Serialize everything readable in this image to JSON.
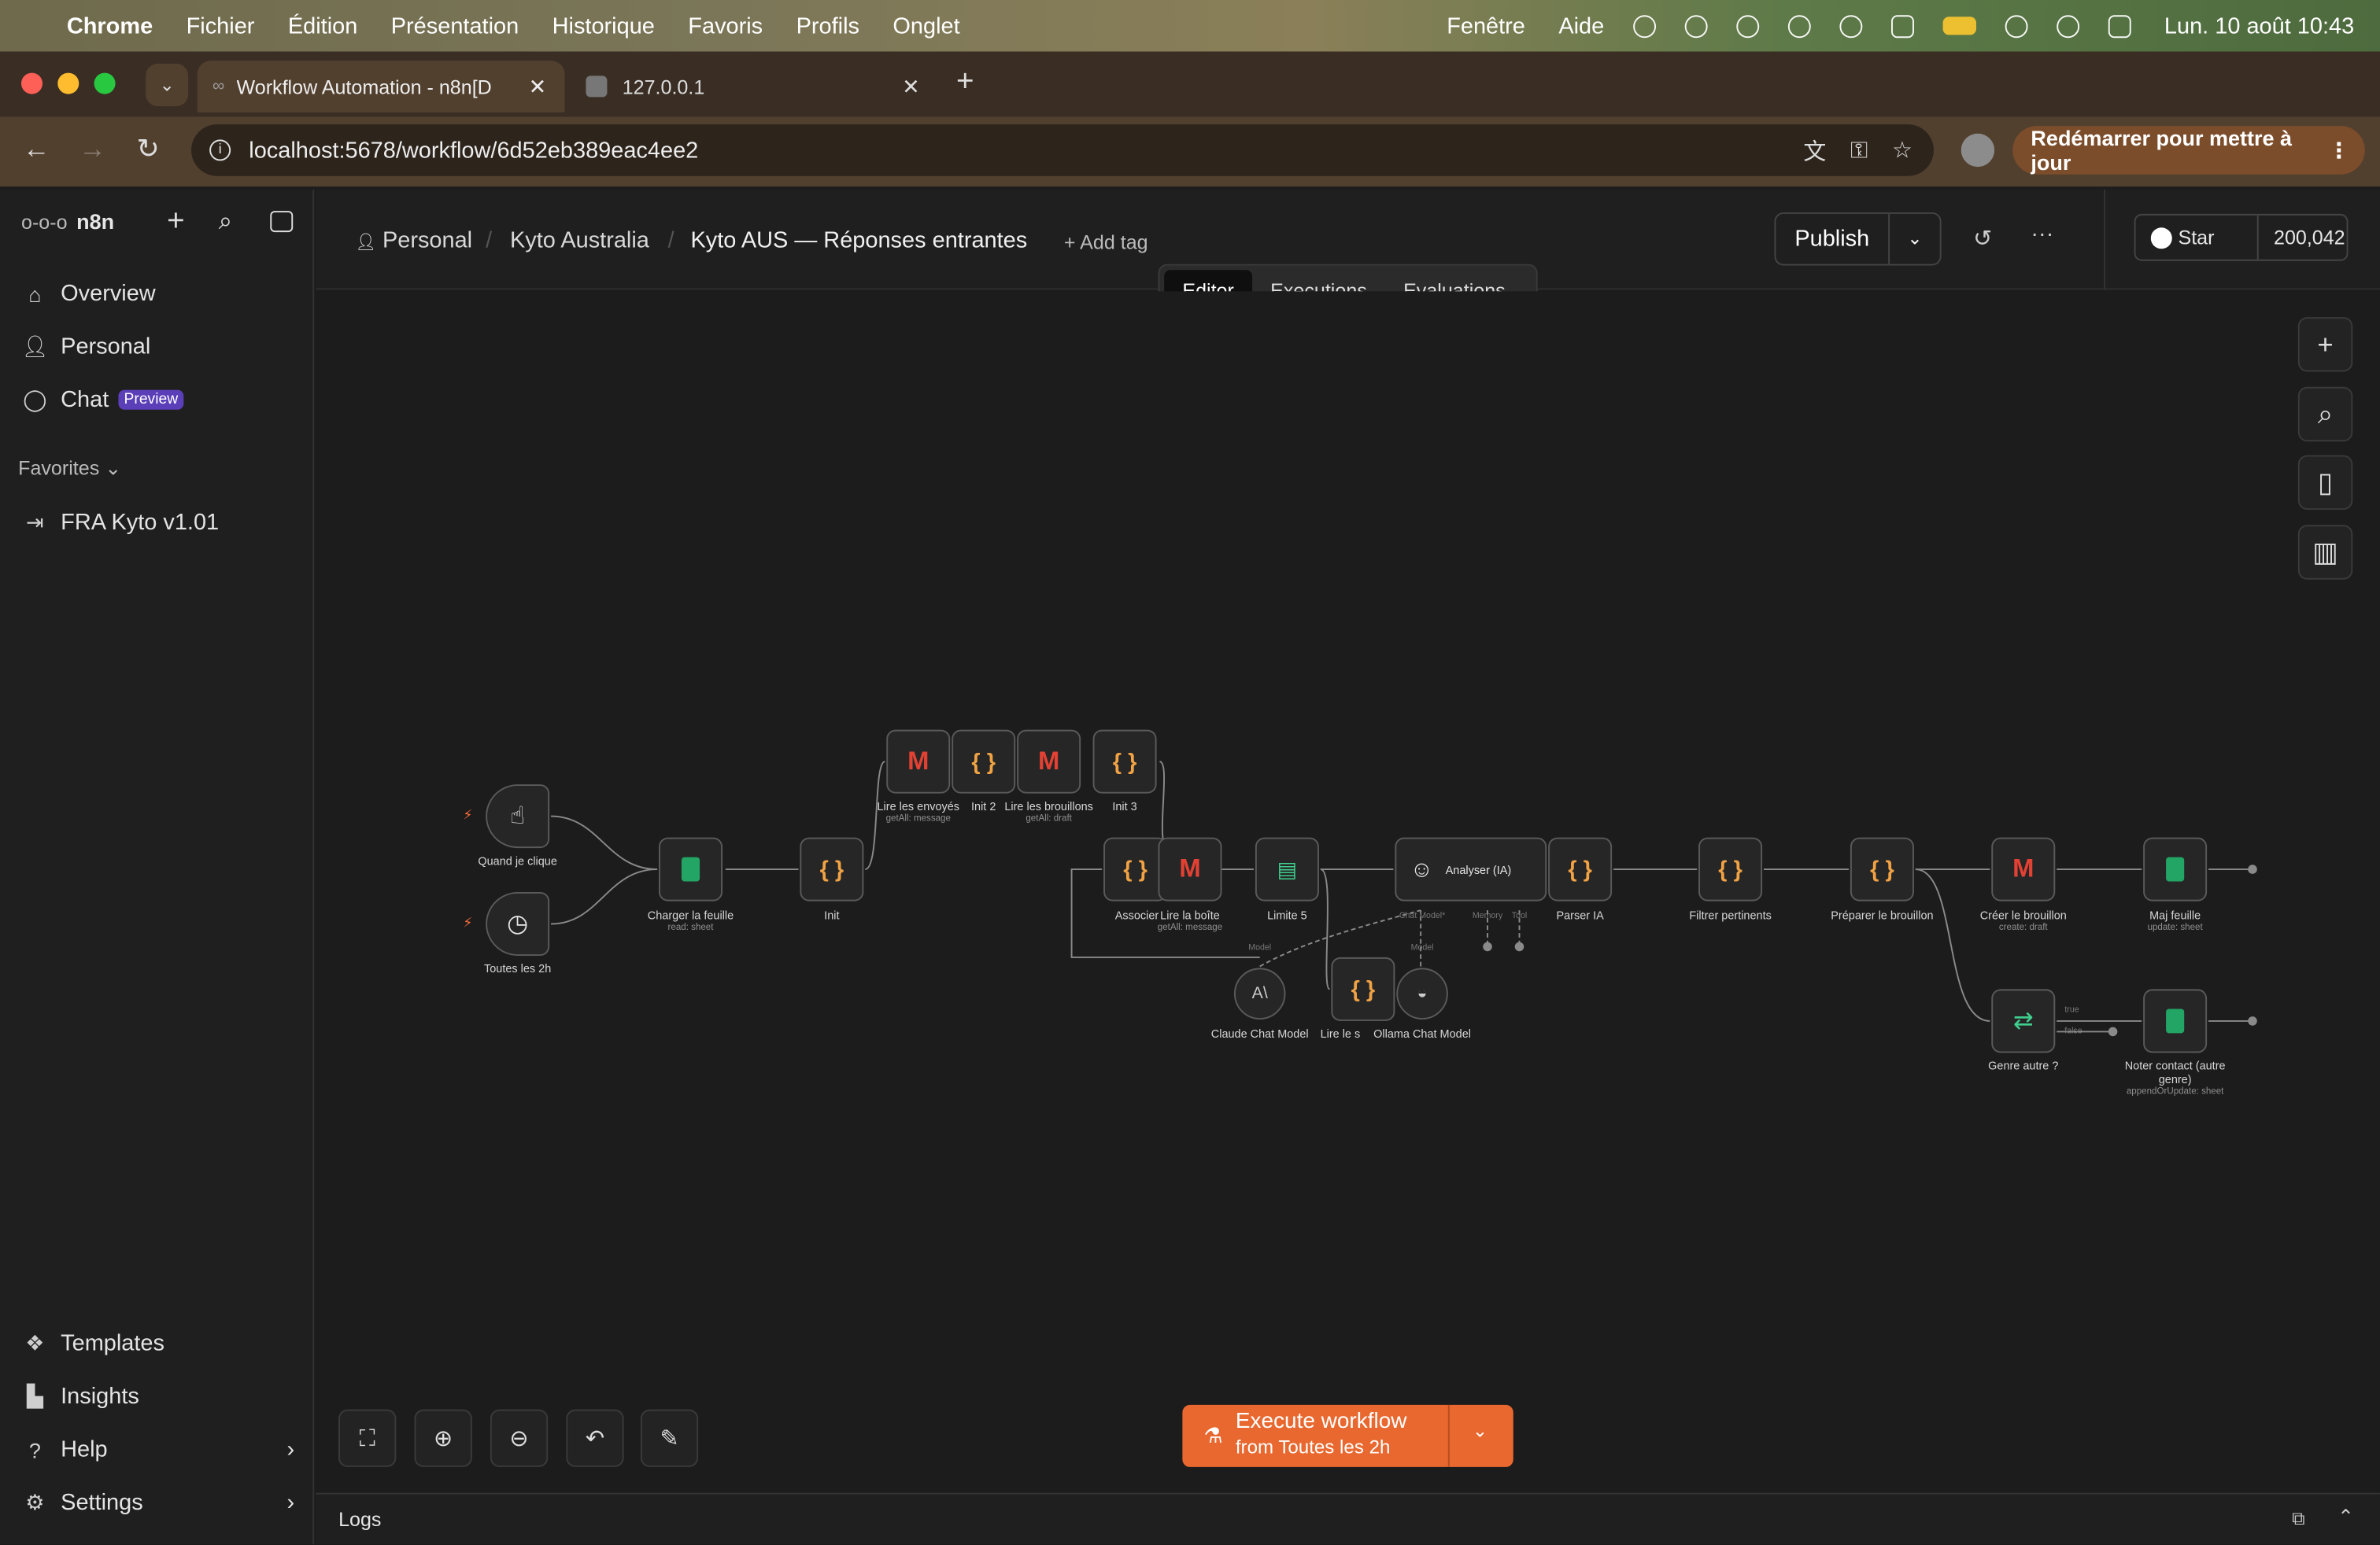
{
  "menubar": {
    "app": "Chrome",
    "items": [
      "Fichier",
      "Édition",
      "Présentation",
      "Historique",
      "Favoris",
      "Profils",
      "Onglet"
    ],
    "right_items": [
      "Fenêtre",
      "Aide"
    ],
    "clock": "Lun. 10 août 10:43"
  },
  "browser": {
    "tabs": [
      {
        "title": "Workflow Automation - n8n[D"
      },
      {
        "title": "127.0.0.1"
      }
    ],
    "url": "localhost:5678/workflow/6d52eb389eac4ee2",
    "update_button": "Redémarrer pour mettre à jour"
  },
  "sidebar": {
    "brand": "n8n",
    "nav": [
      {
        "label": "Overview",
        "icon": "home-icon"
      },
      {
        "label": "Personal",
        "icon": "user-icon"
      },
      {
        "label": "Chat",
        "icon": "chat-icon",
        "badge": "Preview"
      }
    ],
    "favorites_label": "Favorites",
    "favorites": [
      {
        "label": "FRA Kyto v1.01"
      }
    ],
    "bottom": [
      {
        "label": "Templates"
      },
      {
        "label": "Insights"
      },
      {
        "label": "Help"
      },
      {
        "label": "Settings"
      }
    ]
  },
  "header": {
    "breadcrumbs": [
      "Personal",
      "Kyto Australia"
    ],
    "workflow_name": "Kyto AUS — Réponses entrantes",
    "add_tag": "+ Add tag",
    "publish": "Publish",
    "github_star": "Star",
    "github_count": "200,042"
  },
  "editor_tabs": [
    "Editor",
    "Executions",
    "Evaluations"
  ],
  "nodes": {
    "quand": {
      "label": "Quand je clique"
    },
    "toutes": {
      "label": "Toutes les 2h"
    },
    "charger": {
      "label": "Charger la feuille",
      "sub": "read: sheet"
    },
    "init": {
      "label": "Init"
    },
    "lire_env": {
      "label": "Lire les envoyés",
      "sub": "getAll: message"
    },
    "init2": {
      "label": "Init 2"
    },
    "lire_brou": {
      "label": "Lire les brouillons",
      "sub": "getAll: draft"
    },
    "init3": {
      "label": "Init 3"
    },
    "associer": {
      "label": "Associer"
    },
    "lire_boite": {
      "label": "Lire la boîte",
      "sub": "getAll: message"
    },
    "limite": {
      "label": "Limite 5"
    },
    "analyser": {
      "label": "Analyser (IA)",
      "ports": [
        "Chat Model*",
        "Memory",
        "Tool"
      ]
    },
    "parser": {
      "label": "Parser IA"
    },
    "filtrer": {
      "label": "Filtrer pertinents"
    },
    "preparer": {
      "label": "Préparer le brouillon"
    },
    "creer": {
      "label": "Créer le brouillon",
      "sub": "create: draft"
    },
    "maj": {
      "label": "Maj feuille",
      "sub": "update: sheet"
    },
    "claude": {
      "label": "Claude Chat Model",
      "port": "Model"
    },
    "lire_s": {
      "label": "Lire le s"
    },
    "ollama": {
      "label": "Ollama Chat Model",
      "port": "Model"
    },
    "genre": {
      "label": "Genre autre ?",
      "out_true": "true",
      "out_false": "false"
    },
    "noter": {
      "label": "Noter contact (autre genre)",
      "sub": "appendOrUpdate: sheet"
    }
  },
  "execute": {
    "title": "Execute workflow",
    "subtitle": "from Toutes les 2h"
  },
  "logs": {
    "label": "Logs"
  }
}
